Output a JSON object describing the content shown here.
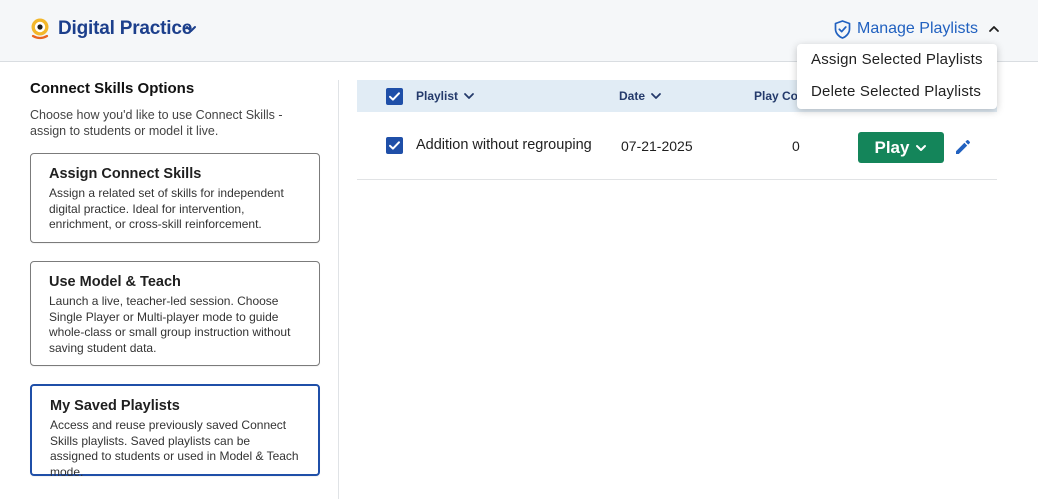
{
  "header": {
    "app_title": "Digital Practice",
    "manage_label": "Manage Playlists",
    "menu": [
      "Assign Selected Playlists",
      "Delete Selected Playlists"
    ]
  },
  "sidebar": {
    "title": "Connect Skills Options",
    "description": "Choose how you'd like to use Connect Skills - assign to students or model it live.",
    "cards": [
      {
        "title": "Assign Connect Skills",
        "description": "Assign a related set of skills for independent digital practice. Ideal for intervention, enrichment, or cross-skill reinforcement."
      },
      {
        "title": "Use Model & Teach",
        "description": "Launch a live, teacher-led session. Choose Single Player or Multi-player mode to guide whole-class or small group instruction without saving student data."
      },
      {
        "title": "My Saved Playlists",
        "description": "Access and reuse previously saved Connect Skills playlists. Saved playlists can be assigned to students or used in Model & Teach mode."
      }
    ]
  },
  "table": {
    "columns": {
      "playlist": "Playlist",
      "date": "Date",
      "play_count": "Play Cou"
    },
    "rows": [
      {
        "name": "Addition without regrouping",
        "date": "07-21-2025",
        "play_count": "0",
        "checked": true
      }
    ],
    "play_label": "Play"
  },
  "colors": {
    "brand_blue": "#1c3f8c",
    "link_blue": "#2161c0",
    "play_green": "#14855a",
    "header_bg": "#e1ecf5"
  },
  "icons": {
    "logo": "eye-logo-icon",
    "shield": "shield-check-icon",
    "edit": "pencil-icon"
  }
}
